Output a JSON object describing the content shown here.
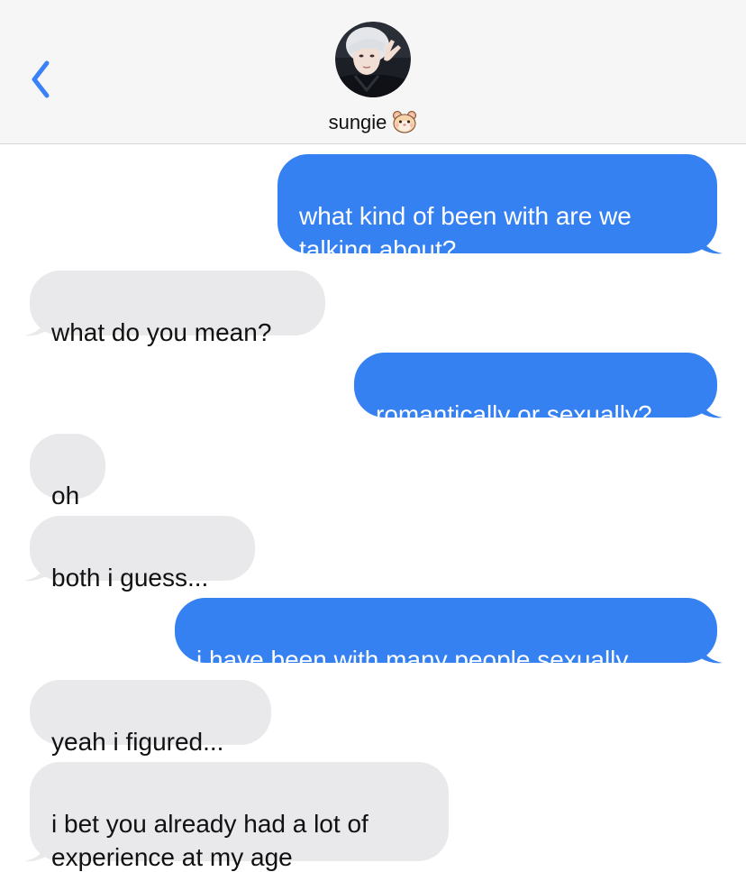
{
  "header": {
    "back_icon": "chevron-left-icon",
    "contact_name": "sungie",
    "contact_emoji": "hamster-face-icon",
    "accent_color": "#3a82f7"
  },
  "messages": [
    {
      "direction": "sent",
      "text": "what kind of been with are we\ntalking about?"
    },
    {
      "direction": "received",
      "text": "what do you mean?"
    },
    {
      "direction": "sent",
      "text": "romantically or sexually?"
    },
    {
      "direction": "received",
      "text": "oh"
    },
    {
      "direction": "received",
      "text": "both i guess..."
    },
    {
      "direction": "sent",
      "text": "i have been with many people sexually"
    },
    {
      "direction": "received",
      "text": "yeah i figured..."
    },
    {
      "direction": "received",
      "text": "i bet you already had a lot of\nexperience at my age"
    }
  ],
  "colors": {
    "sent_bubble": "#3581f2",
    "received_bubble": "#e9e9eb",
    "header_background": "#f6f6f6"
  }
}
